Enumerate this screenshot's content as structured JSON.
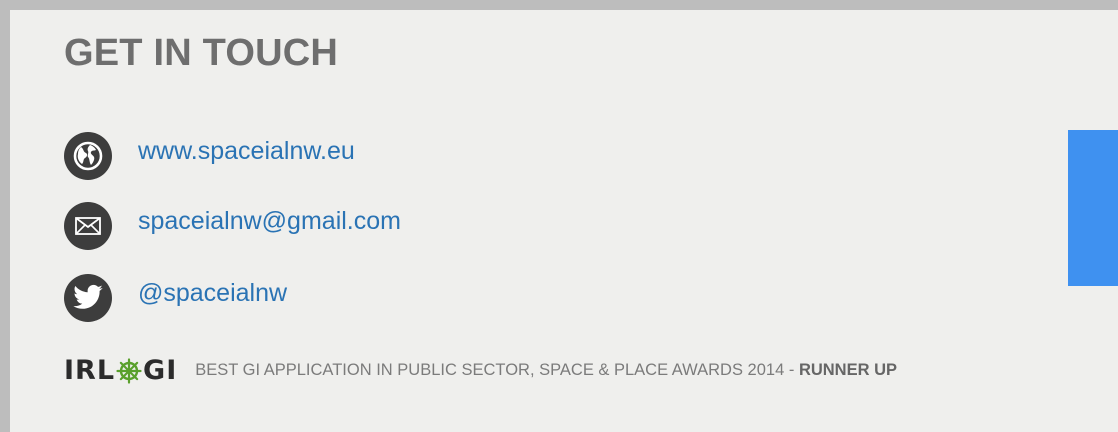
{
  "section": {
    "title": "GET IN TOUCH"
  },
  "contacts": [
    {
      "icon": "globe-icon",
      "text": "www.spaceialnw.eu"
    },
    {
      "icon": "envelope-icon",
      "text": "spaceialnw@gmail.com"
    },
    {
      "icon": "twitter-bird-icon",
      "text": "@spaceialnw"
    }
  ],
  "award": {
    "logo_left": "IRL",
    "logo_right": "GI",
    "description": "BEST GI APPLICATION IN PUBLIC SECTOR, SPACE & PLACE AWARDS 2014",
    "separator": " - ",
    "result": "RUNNER UP"
  },
  "colors": {
    "background": "#efefed",
    "border": "#bdbdbd",
    "title": "#6e6e6e",
    "link": "#2a73b4",
    "icon_circle": "#3d3d3d",
    "side_tab": "#3f91f0",
    "logo_wheel": "#5aa02c"
  }
}
